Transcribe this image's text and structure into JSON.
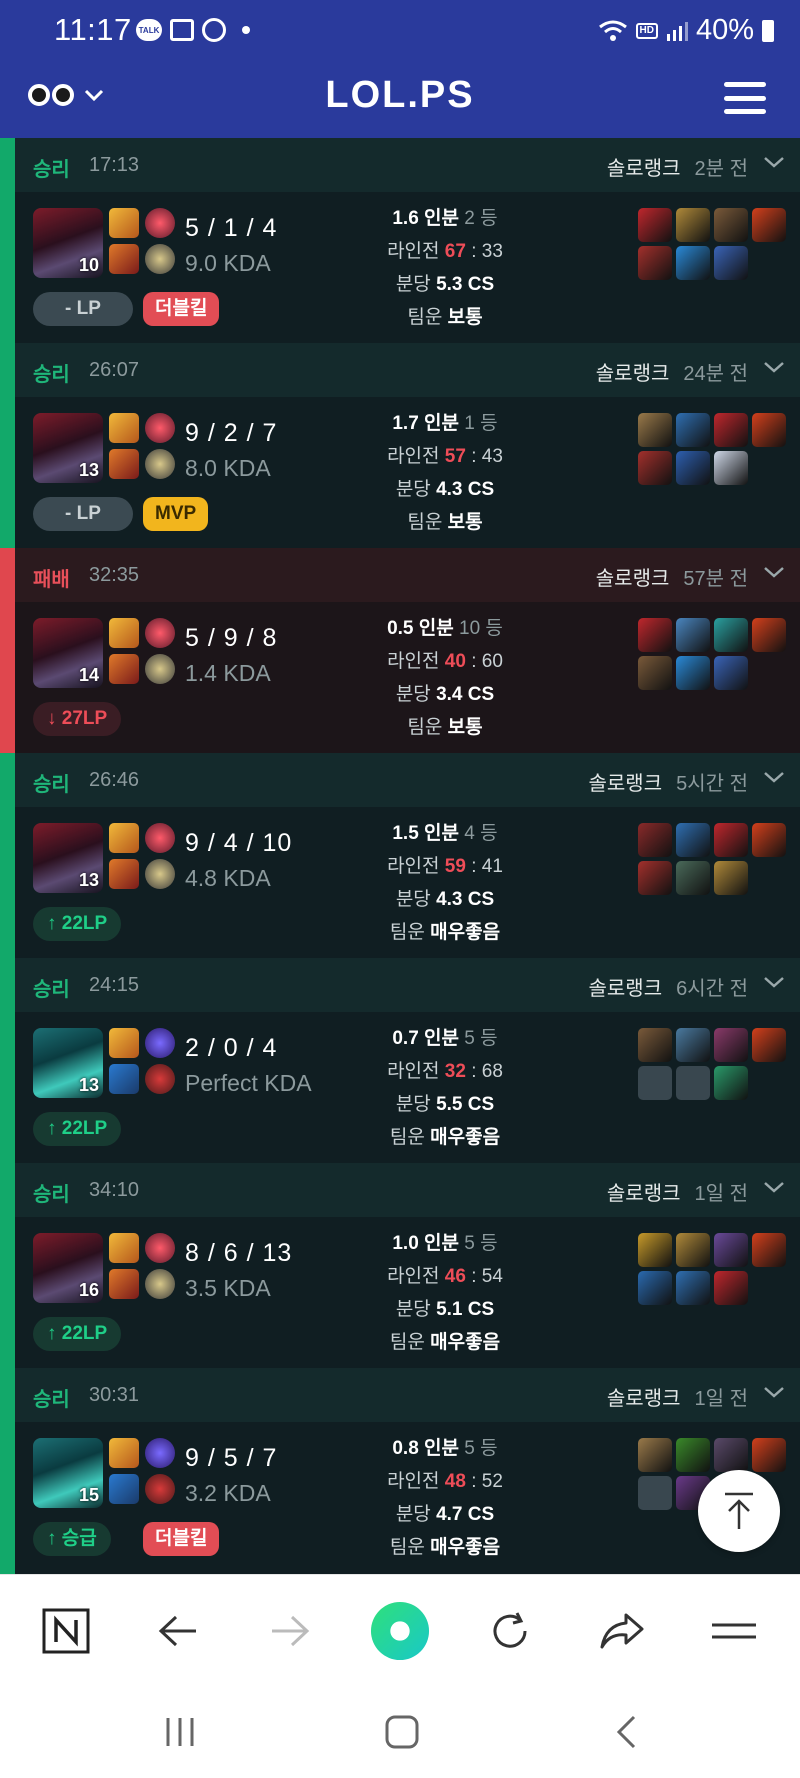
{
  "status_bar": {
    "time": "11:17",
    "notification_chip": "TALK",
    "battery": "40%",
    "hd_voice": "HD"
  },
  "header": {
    "title": "LOL.PS"
  },
  "colors": {
    "header_bg": "#2a3a9c",
    "win": "#12a96a",
    "loss": "#e0474e",
    "red_value": "#ee4d58"
  },
  "matches": [
    {
      "result": "승리",
      "duration": "17:13",
      "queue": "솔로랭크",
      "ago": "2분 전",
      "champion_level": "10",
      "kda": "5 / 1 / 4",
      "kda_ratio": "9.0 KDA",
      "lp": "- LP",
      "badge": "더블킬",
      "share": "1.6 인분",
      "rank": "2 등",
      "lane_a": "67",
      "lane_b": "33",
      "cs": "5.3 CS",
      "luck": "보통"
    },
    {
      "result": "승리",
      "duration": "26:07",
      "queue": "솔로랭크",
      "ago": "24분 전",
      "champion_level": "13",
      "kda": "9 / 2 / 7",
      "kda_ratio": "8.0 KDA",
      "lp": "- LP",
      "badge": "MVP",
      "share": "1.7 인분",
      "rank": "1 등",
      "lane_a": "57",
      "lane_b": "43",
      "cs": "4.3 CS",
      "luck": "보통"
    },
    {
      "result": "패배",
      "duration": "32:35",
      "queue": "솔로랭크",
      "ago": "57분 전",
      "champion_level": "14",
      "kda": "5 / 9 / 8",
      "kda_ratio": "1.4 KDA",
      "lp": "27LP",
      "badge": "",
      "share": "0.5 인분",
      "rank": "10 등",
      "lane_a": "40",
      "lane_b": "60",
      "cs": "3.4 CS",
      "luck": "보통"
    },
    {
      "result": "승리",
      "duration": "26:46",
      "queue": "솔로랭크",
      "ago": "5시간 전",
      "champion_level": "13",
      "kda": "9 / 4 / 10",
      "kda_ratio": "4.8 KDA",
      "lp": "22LP",
      "badge": "",
      "share": "1.5 인분",
      "rank": "4 등",
      "lane_a": "59",
      "lane_b": "41",
      "cs": "4.3 CS",
      "luck": "매우좋음"
    },
    {
      "result": "승리",
      "duration": "24:15",
      "queue": "솔로랭크",
      "ago": "6시간 전",
      "champion_level": "13",
      "kda": "2 / 0 / 4",
      "kda_ratio": "Perfect KDA",
      "lp": "22LP",
      "badge": "",
      "share": "0.7 인분",
      "rank": "5 등",
      "lane_a": "32",
      "lane_b": "68",
      "cs": "5.5 CS",
      "luck": "매우좋음"
    },
    {
      "result": "승리",
      "duration": "34:10",
      "queue": "솔로랭크",
      "ago": "1일 전",
      "champion_level": "16",
      "kda": "8 / 6 / 13",
      "kda_ratio": "3.5 KDA",
      "lp": "22LP",
      "badge": "",
      "share": "1.0 인분",
      "rank": "5 등",
      "lane_a": "46",
      "lane_b": "54",
      "cs": "5.1 CS",
      "luck": "매우좋음"
    },
    {
      "result": "승리",
      "duration": "30:31",
      "queue": "솔로랭크",
      "ago": "1일 전",
      "champion_level": "15",
      "kda": "9 / 5 / 7",
      "kda_ratio": "3.2 KDA",
      "lp": "승급",
      "badge": "더블킬",
      "share": "0.8 인분",
      "rank": "5 등",
      "lane_a": "48",
      "lane_b": "52",
      "cs": "4.7 CS",
      "luck": "매우좋음"
    }
  ],
  "labels": {
    "lane": "라인전",
    "per_min": "분당",
    "team_luck": "팀운"
  },
  "icons": {
    "back_to_top": "arrow-up-icon",
    "browser_home": "naver-n-icon",
    "back": "arrow-left-icon",
    "forward": "arrow-right-icon",
    "home_circle": "green-circle-icon",
    "refresh": "refresh-icon",
    "share": "share-icon",
    "menu": "menu-icon"
  }
}
